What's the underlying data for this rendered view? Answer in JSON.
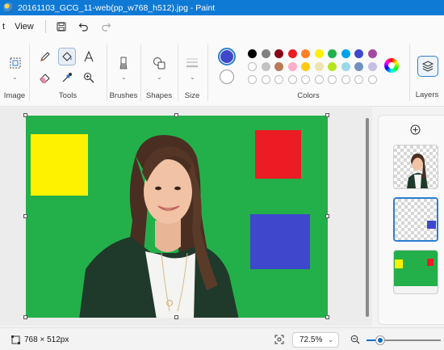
{
  "window": {
    "title": "20161103_GCG_11-web(pp_w768_h512).jpg - Paint"
  },
  "menu": {
    "file_label_clipped": "t",
    "view_label": "View"
  },
  "ribbon": {
    "groups": {
      "image": "Image",
      "tools": "Tools",
      "brushes": "Brushes",
      "shapes": "Shapes",
      "size": "Size",
      "colors": "Colors",
      "layers": "Layers"
    },
    "tools": [
      "pencil",
      "fill",
      "text",
      "eraser",
      "color-picker",
      "magnifier"
    ],
    "primary_color": "#3f48cc",
    "secondary_color": "#ffffff",
    "palette_row1": [
      "#000000",
      "#7f7f7f",
      "#880015",
      "#ed1c24",
      "#ff7f27",
      "#fff200",
      "#22b14c",
      "#00a2e8",
      "#3f48cc",
      "#a349a4"
    ],
    "palette_row2": [
      "#ffffff",
      "#c3c3c3",
      "#b97a57",
      "#ffaec9",
      "#ffc90e",
      "#efe4b0",
      "#b5e61d",
      "#99d9ea",
      "#7092be",
      "#c8bfe7"
    ]
  },
  "canvas": {
    "background": "#23b04a",
    "shapes": [
      {
        "name": "yellow-rectangle",
        "color": "#fef200"
      },
      {
        "name": "red-rectangle",
        "color": "#ec1c24"
      },
      {
        "name": "blue-rectangle",
        "color": "#3f48cc"
      }
    ]
  },
  "layers": [
    {
      "name": "person-layer"
    },
    {
      "name": "blue-square-layer",
      "selected": true
    },
    {
      "name": "background-layer"
    }
  ],
  "status": {
    "dimensions": "768 × 512px",
    "zoom": "72.5%",
    "zoom_level": 0.18
  }
}
